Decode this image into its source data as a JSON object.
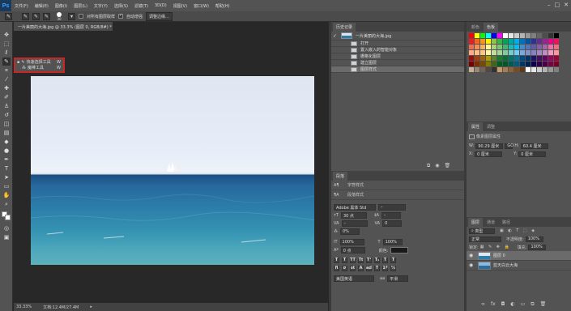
{
  "menu": [
    "文件(F)",
    "编辑(E)",
    "图像(I)",
    "图层(L)",
    "文字(Y)",
    "选择(S)",
    "滤镜(T)",
    "3D(D)",
    "视图(V)",
    "窗口(W)",
    "帮助(H)"
  ],
  "app_logo": "Ps",
  "options": {
    "sample_all_layers": "对所有图层取样",
    "auto_enhance": "自动增强",
    "refine_edge": "调整边缘...",
    "brush_size": "30"
  },
  "document": {
    "tab": "一片美丽的大海.jpg @ 33.3% (图层 0, RGB/8#) *",
    "zoom": "33.33%",
    "doc_size": "文档:12.4M/27.4M"
  },
  "flyout": [
    {
      "label": "快速选择工具",
      "shortcut": "W"
    },
    {
      "label": "魔棒工具",
      "shortcut": "W"
    }
  ],
  "history": {
    "tabs": [
      "历史记录"
    ],
    "snapshot": "一片美丽的大海.jpg",
    "items": [
      "打开",
      "置入嵌入的智能对象",
      "栅格化图层",
      "建立图层",
      "图层样式"
    ],
    "selected_index": 4
  },
  "character": {
    "tabs": [
      "段落",
      "字符样式",
      "段落样式"
    ],
    "font": "Adobe 黑体 Std",
    "size": "30 点",
    "tracking": "0",
    "scale_v": "100%",
    "scale_h": "100%",
    "baseline": "0 点",
    "color_label": "颜色:",
    "language": "美国英语",
    "aa_icon": "aa",
    "antialias": "平滑",
    "kerning": "0%"
  },
  "swatches": {
    "tabs": [
      "颜色",
      "色板"
    ],
    "colors": [
      "#ff0000",
      "#ffff00",
      "#00ff00",
      "#00ffff",
      "#0000ff",
      "#ff00ff",
      "#ffffff",
      "#e6e6e6",
      "#cccccc",
      "#b3b3b3",
      "#999999",
      "#808080",
      "#666666",
      "#4d4d4d",
      "#333333",
      "#000000",
      "#ed1c24",
      "#f26522",
      "#f7941d",
      "#fff200",
      "#8dc63f",
      "#39b54a",
      "#00a651",
      "#00a99d",
      "#00aeef",
      "#0072bc",
      "#0054a6",
      "#2e3192",
      "#662d91",
      "#92278f",
      "#ec008c",
      "#ed145b",
      "#f26c4f",
      "#f68e56",
      "#fbaf5d",
      "#fff799",
      "#acd373",
      "#7cc576",
      "#3bb878",
      "#1abbb4",
      "#00bff3",
      "#448ccb",
      "#5674b9",
      "#605ca8",
      "#8560a8",
      "#a864a8",
      "#f06eaa",
      "#f26d7d",
      "#f9ad81",
      "#fbc08a",
      "#fdc689",
      "#fff9ae",
      "#c4df9b",
      "#a3d39c",
      "#82ca9c",
      "#7accc8",
      "#6dcff6",
      "#7da7d9",
      "#8393ca",
      "#8781bd",
      "#a187be",
      "#bc8dbf",
      "#f49ac2",
      "#f6989d",
      "#9e0b0f",
      "#a0410d",
      "#a36209",
      "#aba000",
      "#598527",
      "#1a7b30",
      "#007236",
      "#00746b",
      "#0076a3",
      "#004a80",
      "#003471",
      "#1b1464",
      "#440e62",
      "#630460",
      "#9e005d",
      "#9e0039",
      "#790000",
      "#7b2e00",
      "#7d4900",
      "#827b00",
      "#406618",
      "#005e20",
      "#005826",
      "#005952",
      "#005b7f",
      "#003663",
      "#002157",
      "#0d004c",
      "#32004b",
      "#4b0049",
      "#7b0046",
      "#7a0026",
      "#c7b299",
      "#998675",
      "#736357",
      "#534741",
      "#37302d",
      "#c69c6d",
      "#a67c52",
      "#8c6239",
      "#754c24",
      "#603913",
      "#ffffff",
      "#e6e6e6",
      "#cccccc",
      "#b3b3b3",
      "#999999",
      "#808080"
    ]
  },
  "properties": {
    "tabs": [
      "属性",
      "调整"
    ],
    "title": "像素图层属性",
    "w_label": "W:",
    "w": "90.29 厘米",
    "h_label": "H:",
    "h": "60.4 厘米",
    "x_label": "X:",
    "x": "0 厘米",
    "y_label": "Y:",
    "y": "0 厘米",
    "link_label": "GO"
  },
  "layers": {
    "tabs": [
      "图层",
      "通道",
      "路径"
    ],
    "filter": "类型",
    "blend": "正常",
    "opacity_label": "不透明度:",
    "opacity": "100%",
    "lock_label": "锁定:",
    "fill_label": "填充:",
    "fill": "100%",
    "items": [
      {
        "name": "图层 0",
        "selected": true
      },
      {
        "name": "蓝天白云大海",
        "selected": false
      }
    ],
    "footer_icons": [
      "link-icon",
      "fx-icon",
      "mask-icon",
      "adjust-icon",
      "folder-icon",
      "new-layer-icon",
      "trash-icon"
    ]
  }
}
